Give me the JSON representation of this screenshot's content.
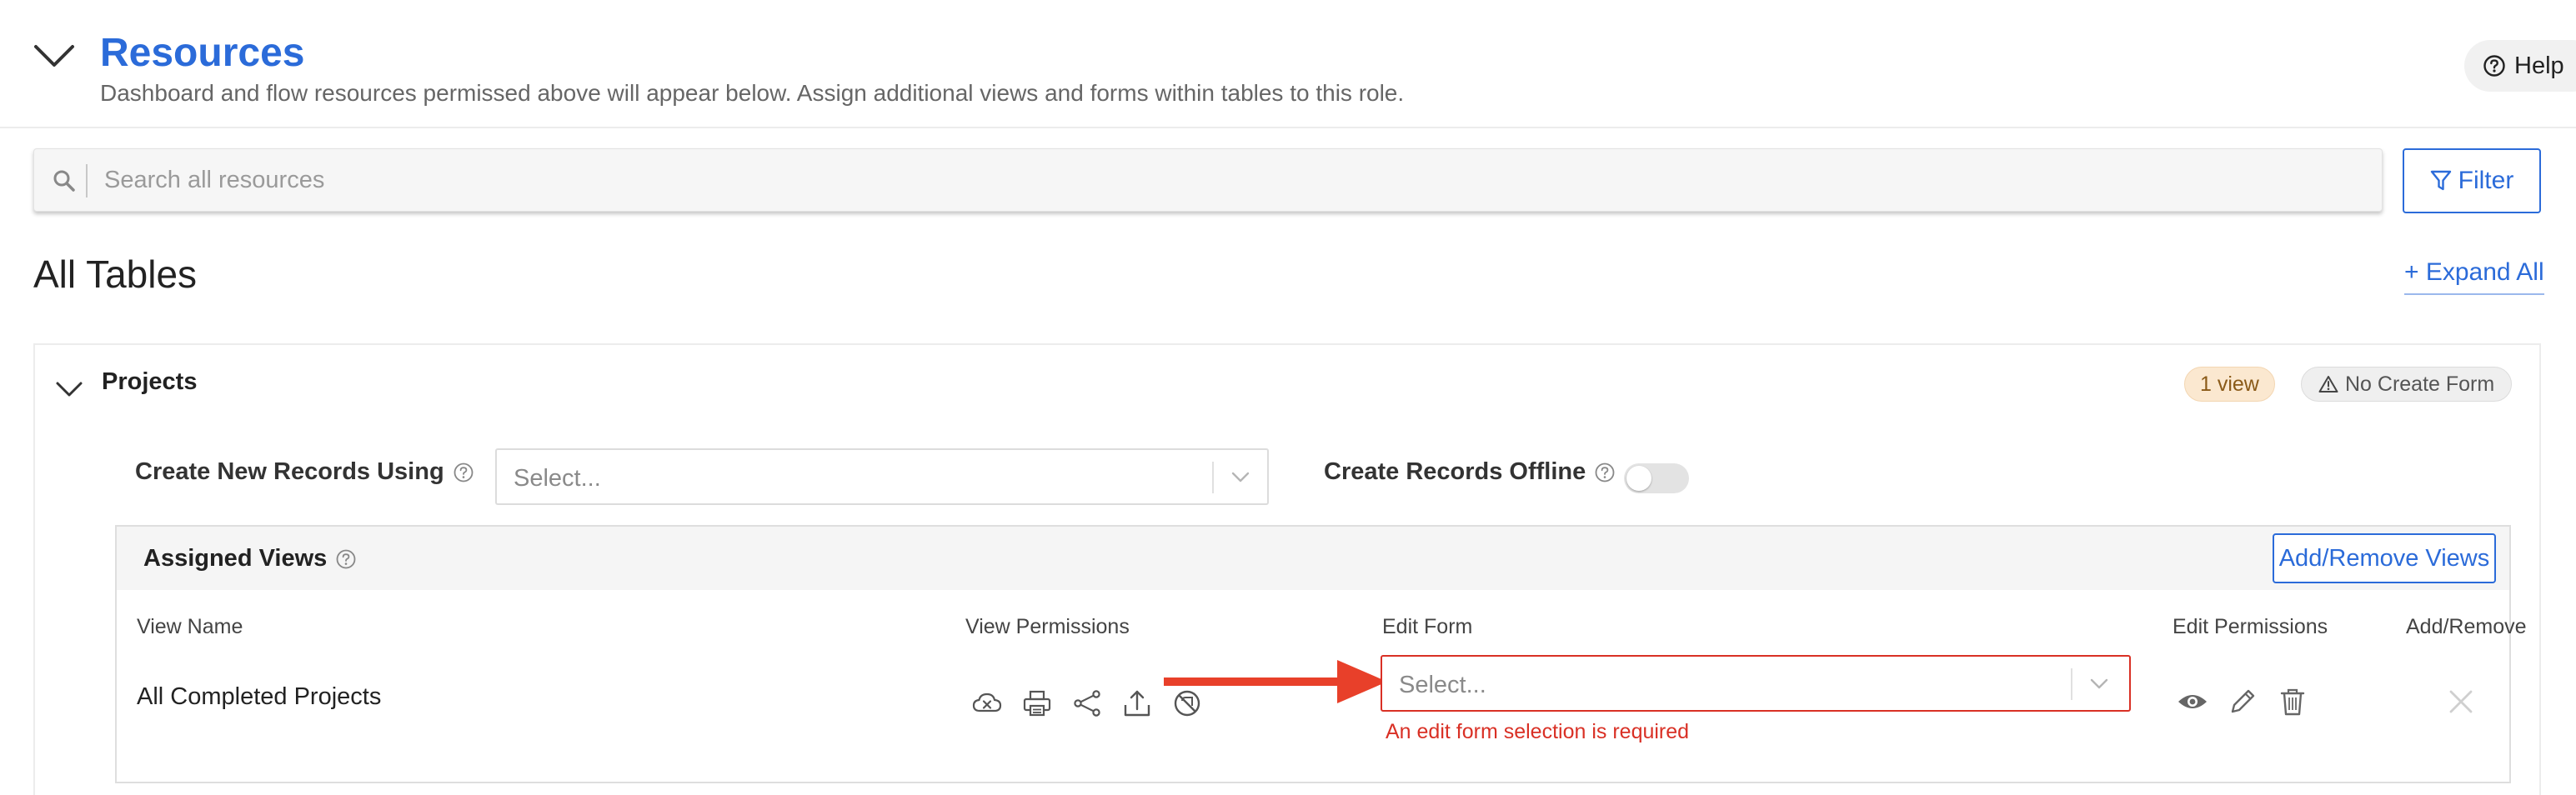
{
  "header": {
    "title": "Resources",
    "subtitle": "Dashboard and flow resources permissed above will appear below. Assign additional views and forms within tables to this role.",
    "help_label": "Help"
  },
  "search": {
    "placeholder": "Search all resources",
    "value": ""
  },
  "toolbar": {
    "filter_label": "Filter"
  },
  "section": {
    "title": "All Tables",
    "expand_all_label": "+ Expand All"
  },
  "table": {
    "name": "Projects",
    "views_badge": "1 view",
    "no_create_form_badge": "No Create Form",
    "create_new_label": "Create New Records Using",
    "create_new_placeholder": "Select...",
    "create_offline_label": "Create Records Offline",
    "create_offline_enabled": false,
    "assigned_views": {
      "title": "Assigned Views",
      "add_remove_label": "Add/Remove Views",
      "columns": {
        "view_name": "View Name",
        "view_permissions": "View Permissions",
        "edit_form": "Edit Form",
        "edit_permissions": "Edit Permissions",
        "add_remove": "Add/Remove"
      },
      "rows": [
        {
          "view_name": "All Completed Projects",
          "view_permission_icons": [
            "offline-disabled-icon",
            "print-icon",
            "share-icon",
            "export-icon",
            "no-access-icon"
          ],
          "edit_form_placeholder": "Select...",
          "edit_form_error": "An edit form selection is required",
          "edit_permission_icons": [
            "eye-icon",
            "pencil-icon",
            "trash-icon"
          ]
        }
      ]
    }
  },
  "colors": {
    "accent": "#2b6bd9",
    "error": "#d93025",
    "arrow": "#e8402a",
    "badge_view_bg": "#fbe8d0"
  }
}
